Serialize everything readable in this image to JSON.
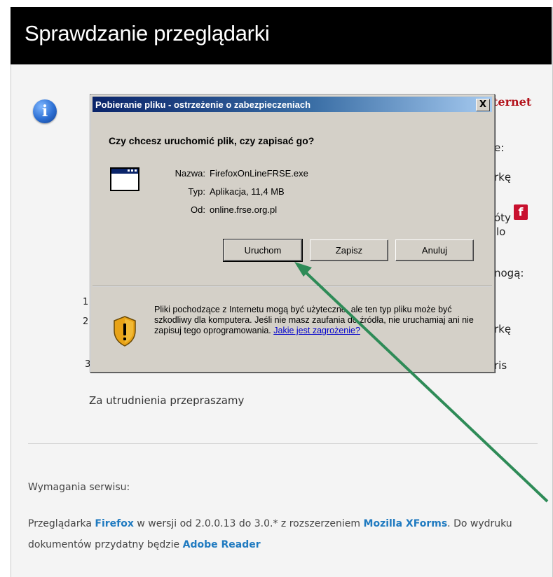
{
  "page": {
    "title": "Sprawdzanie przeglądarki",
    "partial_texts": [
      "ternet",
      "e:",
      "rkę",
      "óty",
      "lo",
      "nogą:",
      "1",
      "2",
      "rkę",
      "3",
      "ris"
    ],
    "sorry_text": "Za utrudnienia przepraszamy",
    "requirements_title": "Wymagania serwisu:",
    "requirements": {
      "t1": "Przeglądarka ",
      "firefox": "Firefox",
      "t2": " w wersji od 2.0.0.13 do 3.0.* z rozszerzeniem ",
      "mozilla": "Mozilla XForms",
      "t3": ". Do wydruku dokumentów przydatny będzie ",
      "adobe": "Adobe Reader"
    },
    "facebook_icon_text": "f"
  },
  "dialog": {
    "title": "Pobieranie pliku - ostrzeżenie o zabezpieczeniach",
    "close_label": "X",
    "question": "Czy chcesz uruchomić plik, czy zapisać go?",
    "fields": {
      "name_label": "Nazwa:",
      "name_value": "FirefoxOnLineFRSE.exe",
      "type_label": "Typ:",
      "type_value": "Aplikacja, 11,4 MB",
      "from_label": "Od:",
      "from_value": "online.frse.org.pl"
    },
    "buttons": {
      "run": "Uruchom",
      "save": "Zapisz",
      "cancel": "Anuluj"
    },
    "warning_text": "Pliki pochodzące z Internetu mogą być użyteczne, ale ten typ pliku może być szkodliwy dla komputera. Jeśli nie masz zaufania do źródła, nie uruchamiaj ani nie zapisuj tego oprogramowania. ",
    "warning_link": "Jakie jest zagrożenie?"
  },
  "icons": {
    "info": "info-icon",
    "app": "application-window-icon",
    "shield": "security-shield-icon",
    "arrow": "pointer-arrow"
  },
  "colors": {
    "header_bg": "#000000",
    "titlebar_start": "#0a246a",
    "arrow": "#2e8b57",
    "link": "#1f7ac0",
    "accent_red": "#b3121b"
  }
}
